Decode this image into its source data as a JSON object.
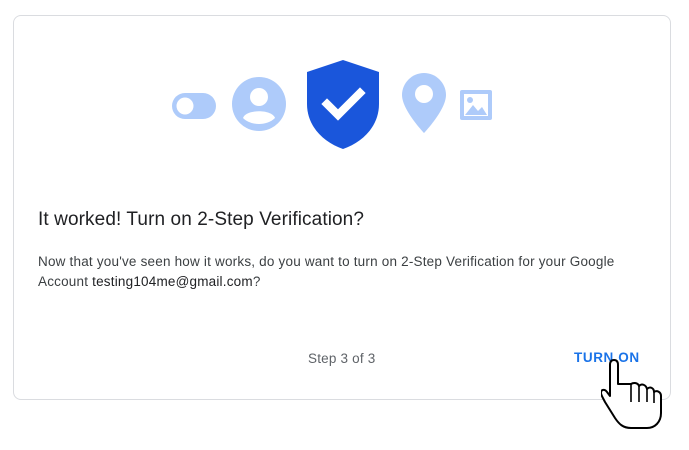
{
  "illustration": {
    "icons": [
      "toggle-icon",
      "account-circle-icon",
      "shield-check-icon",
      "location-pin-icon",
      "image-icon"
    ],
    "accent_color": "#1a73e8",
    "light_color": "#aecbfa"
  },
  "dialog": {
    "title": "It worked! Turn on 2-Step Verification?",
    "body_prefix": "Now that you've seen how it works, do you want to turn on 2-Step Verification for your Google Account ",
    "email": "testing104me@gmail.com",
    "body_suffix": "?",
    "step_text": "Step 3 of 3",
    "turn_on_label": "TURN ON"
  },
  "cursor": {
    "icon": "hand-pointer-cursor-icon"
  }
}
